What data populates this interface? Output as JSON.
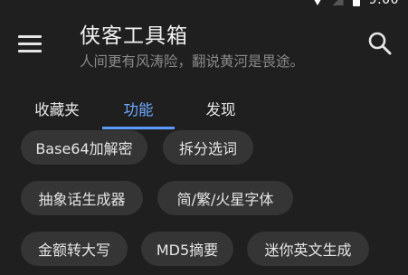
{
  "status_bar": {
    "time": "9:00",
    "icons": [
      "wifi-icon",
      "signal-icon",
      "battery-icon"
    ]
  },
  "app_bar": {
    "menu_icon": "menu-icon",
    "title": "侠客工具箱",
    "subtitle": "人间更有风涛险，翻说黄河是畏途。",
    "search_icon": "search-icon"
  },
  "tabs": [
    {
      "label": "收藏夹",
      "active": false
    },
    {
      "label": "功能",
      "active": true
    },
    {
      "label": "发现",
      "active": false
    }
  ],
  "tools": [
    {
      "label": "Base64加解密"
    },
    {
      "label": "拆分选词"
    },
    {
      "label": "抽象话生成器"
    },
    {
      "label": "简/繁/火星字体"
    },
    {
      "label": "金额转大写"
    },
    {
      "label": "MD5摘要"
    },
    {
      "label": "迷你英文生成"
    }
  ],
  "colors": {
    "background": "#1f1f1f",
    "chip_background": "#353535",
    "accent": "#5b9bff",
    "text_primary": "#f2f2f2",
    "text_secondary": "#8a8a8a"
  }
}
